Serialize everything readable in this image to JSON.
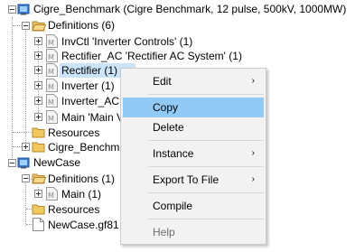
{
  "tree": {
    "cigre_label": "Cigre_Benchmark (Cigre Benchmark, 12 pulse, 500kV, 1000MW)",
    "cigre_definitions": "Definitions (6)",
    "invctl": "InvCtl 'Inverter Controls' (1)",
    "rectifier_ac": "Rectifier_AC 'Rectifier AC System' (1)",
    "rectifier": "Rectifier (1)",
    "inverter": "Inverter (1)",
    "inverter_ac": "Inverter_AC",
    "main_cigre": "Main 'Main V",
    "resources": "Resources",
    "cigre_file": "Cigre_Benchm",
    "newcase_label": "NewCase",
    "newcase_definitions": "Definitions (1)",
    "main_newcase": "Main (1)",
    "newcase_resources": "Resources",
    "newcase_file": "NewCase.gf81"
  },
  "context_menu": {
    "edit": "Edit",
    "copy": "Copy",
    "delete": "Delete",
    "instance": "Instance",
    "export_to_file": "Export To File",
    "compile": "Compile",
    "help": "Help",
    "submenu_arrow": "›"
  },
  "colors": {
    "selection": "#cce4f7",
    "menu_hover": "#91c9f7",
    "menu_bg": "#f2f2f2",
    "disabled_text": "#6d6d6d"
  }
}
